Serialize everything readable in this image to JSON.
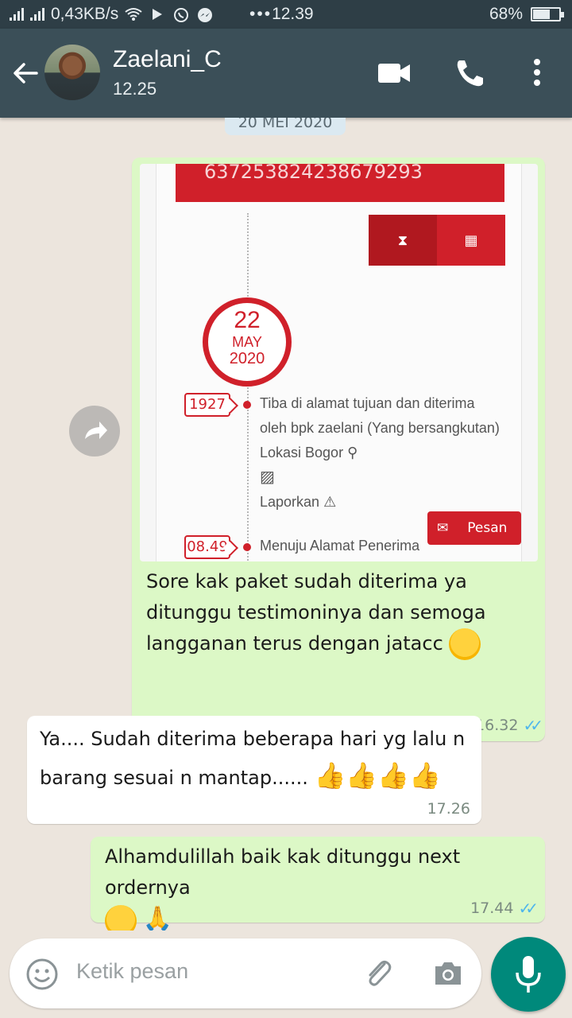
{
  "status_bar": {
    "network_speed": "0,43KB/s",
    "time": "12.39",
    "battery": "68%",
    "battery_level": 0.68
  },
  "header": {
    "contact_name": "Zaelani_C",
    "contact_status": "12.25"
  },
  "chat": {
    "date_chip": "20 MEI 2020",
    "messages": [
      {
        "direction": "outgoing",
        "image": {
          "tracking_number": "637253824238679293",
          "day": "22",
          "month": "MAY",
          "year": "2020",
          "events": [
            {
              "time": "1927",
              "lines": [
                "Tiba di alamat tujuan dan diterima",
                "oleh bpk zaelani (Yang bersangkutan)",
                "Lokasi Bogor"
              ],
              "report_label": "Laporkan"
            },
            {
              "time": "08.49",
              "lines": [
                "Menuju Alamat Penerima"
              ]
            }
          ],
          "pesan_label": "Pesan"
        },
        "text": "Sore kak paket sudah diterima ya ditunggu testimoninya dan semoga langganan terus dengan jatacc",
        "time": "16.32"
      },
      {
        "direction": "incoming",
        "text_line1": "Ya.... Sudah diterima beberapa hari yg lalu n",
        "text_line2": "barang sesuai n mantap......",
        "time": "17.26"
      },
      {
        "direction": "outgoing",
        "text": "Alhamdulillah baik kak ditunggu next ordernya",
        "time": "17.44"
      }
    ]
  },
  "input": {
    "placeholder": "Ketik pesan"
  },
  "colors": {
    "app_bar": "#3b4f58",
    "outgoing_bubble": "#dcf8c6",
    "incoming_bubble": "#ffffff",
    "read_ticks": "#4fb6ec",
    "mic_button": "#00897b",
    "accent_red": "#d0202a"
  },
  "icons": [
    "back-arrow-icon",
    "video-call-icon",
    "phone-icon",
    "more-vert-icon",
    "forward-icon",
    "emoji-icon",
    "attach-icon",
    "camera-icon",
    "mic-icon"
  ]
}
